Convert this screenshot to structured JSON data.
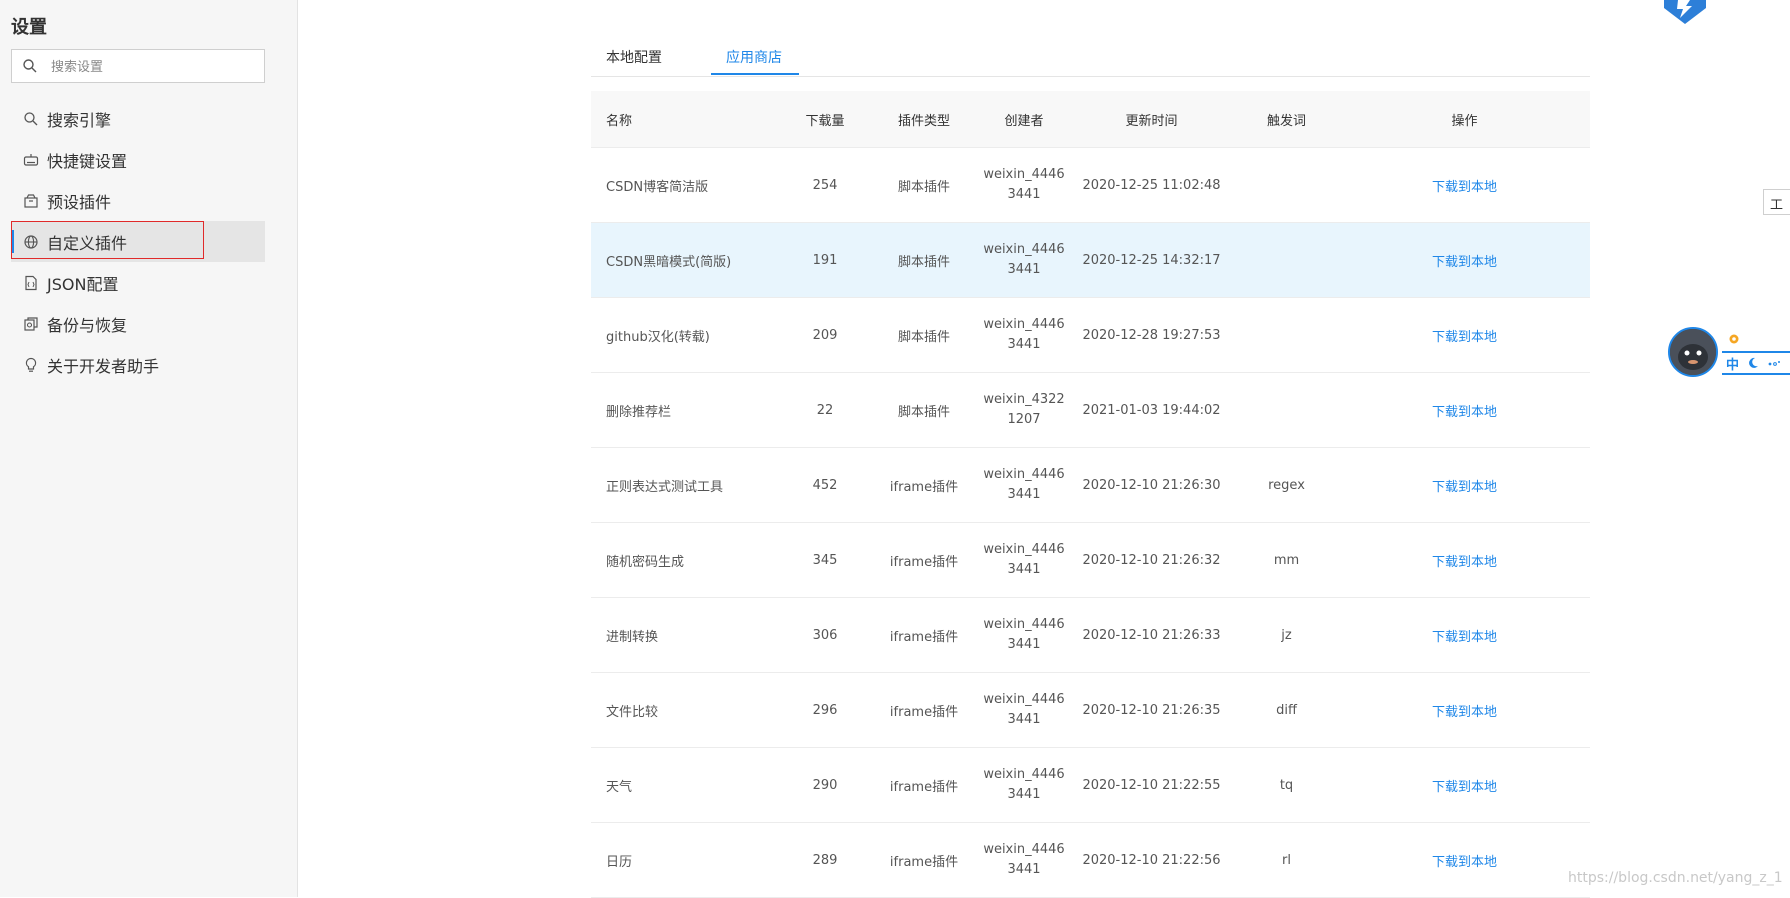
{
  "sidebar": {
    "title": "设置",
    "search_placeholder": "搜索设置",
    "items": [
      {
        "label": "搜索引擎",
        "icon": "search-icon"
      },
      {
        "label": "快捷键设置",
        "icon": "keyboard-icon"
      },
      {
        "label": "预设插件",
        "icon": "package-icon"
      },
      {
        "label": "自定义插件",
        "icon": "globe-icon",
        "active": true
      },
      {
        "label": "JSON配置",
        "icon": "json-file-icon"
      },
      {
        "label": "备份与恢复",
        "icon": "backup-icon"
      },
      {
        "label": "关于开发者助手",
        "icon": "lightbulb-icon"
      }
    ]
  },
  "tabs": {
    "local": "本地配置",
    "store": "应用商店",
    "active": "store"
  },
  "table": {
    "headers": {
      "name": "名称",
      "downloads": "下载量",
      "type": "插件类型",
      "creator": "创建者",
      "updated": "更新时间",
      "trigger": "触发词",
      "action": "操作"
    },
    "rows": [
      {
        "name": "CSDN博客简洁版",
        "downloads": "254",
        "type": "脚本插件",
        "creator_1": "weixin_4446",
        "creator_2": "3441",
        "updated": "2020-12-25 11:02:48",
        "trigger": "",
        "action": "下载到本地"
      },
      {
        "name": "CSDN黑暗模式(简版)",
        "downloads": "191",
        "type": "脚本插件",
        "creator_1": "weixin_4446",
        "creator_2": "3441",
        "updated": "2020-12-25 14:32:17",
        "trigger": "",
        "action": "下载到本地"
      },
      {
        "name": "github汉化(转载)",
        "downloads": "209",
        "type": "脚本插件",
        "creator_1": "weixin_4446",
        "creator_2": "3441",
        "updated": "2020-12-28 19:27:53",
        "trigger": "",
        "action": "下载到本地"
      },
      {
        "name": "删除推荐栏",
        "downloads": "22",
        "type": "脚本插件",
        "creator_1": "weixin_4322",
        "creator_2": "1207",
        "updated": "2021-01-03 19:44:02",
        "trigger": "",
        "action": "下载到本地"
      },
      {
        "name": "正则表达式测试工具",
        "downloads": "452",
        "type": "iframe插件",
        "creator_1": "weixin_4446",
        "creator_2": "3441",
        "updated": "2020-12-10 21:26:30",
        "trigger": "regex",
        "action": "下载到本地"
      },
      {
        "name": "随机密码生成",
        "downloads": "345",
        "type": "iframe插件",
        "creator_1": "weixin_4446",
        "creator_2": "3441",
        "updated": "2020-12-10 21:26:32",
        "trigger": "mm",
        "action": "下载到本地"
      },
      {
        "name": "进制转换",
        "downloads": "306",
        "type": "iframe插件",
        "creator_1": "weixin_4446",
        "creator_2": "3441",
        "updated": "2020-12-10 21:26:33",
        "trigger": "jz",
        "action": "下载到本地"
      },
      {
        "name": "文件比较",
        "downloads": "296",
        "type": "iframe插件",
        "creator_1": "weixin_4446",
        "creator_2": "3441",
        "updated": "2020-12-10 21:26:35",
        "trigger": "diff",
        "action": "下载到本地"
      },
      {
        "name": "天气",
        "downloads": "290",
        "type": "iframe插件",
        "creator_1": "weixin_4446",
        "creator_2": "3441",
        "updated": "2020-12-10 21:22:55",
        "trigger": "tq",
        "action": "下载到本地"
      },
      {
        "name": "日历",
        "downloads": "289",
        "type": "iframe插件",
        "creator_1": "weixin_4446",
        "creator_2": "3441",
        "updated": "2020-12-10 21:22:56",
        "trigger": "rl",
        "action": "下载到本地"
      }
    ]
  },
  "edge": {
    "tab_label": "工",
    "ime_label": "中",
    "watermark": "https://blog.csdn.net/yang_z_1"
  },
  "colors": {
    "accent": "#1f87e8",
    "highlight_border": "#e02a2a",
    "hover_row": "#e8f5fd"
  }
}
